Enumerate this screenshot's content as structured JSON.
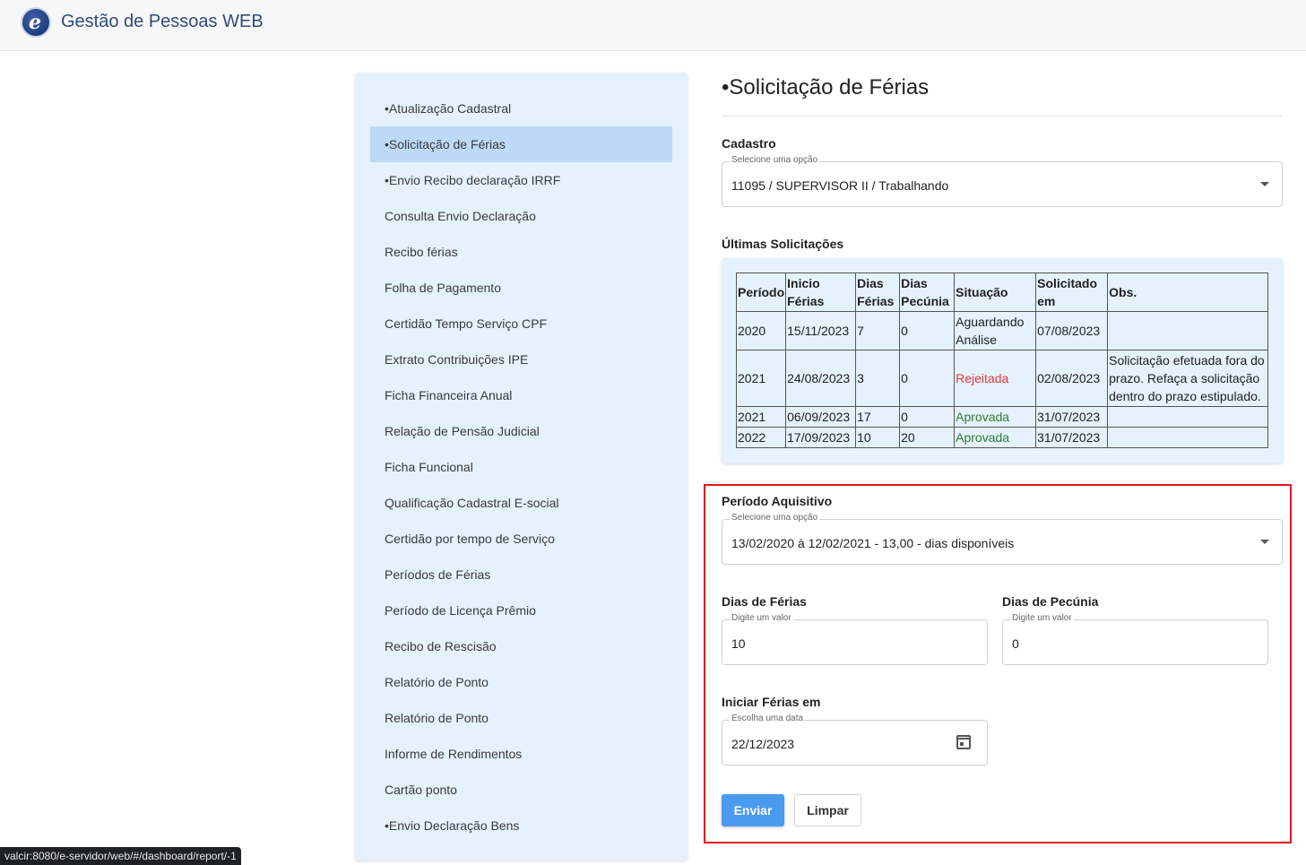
{
  "app": {
    "title": "Gestão de Pessoas WEB",
    "logo_letter": "e"
  },
  "sidebar": {
    "items": [
      {
        "label": "•Atualização Cadastral"
      },
      {
        "label": "•Solicitação de Férias",
        "active": true
      },
      {
        "label": "•Envio Recibo declaração IRRF"
      },
      {
        "label": "Consulta Envio Declaração"
      },
      {
        "label": "Recibo férias"
      },
      {
        "label": "Folha de Pagamento"
      },
      {
        "label": "Certidão Tempo Serviço CPF"
      },
      {
        "label": "Extrato Contribuições IPE"
      },
      {
        "label": "Ficha Financeira Anual"
      },
      {
        "label": "Relação de Pensão Judicial"
      },
      {
        "label": "Ficha Funcional"
      },
      {
        "label": "Qualificação Cadastral E-social"
      },
      {
        "label": "Certidão por tempo de Serviço"
      },
      {
        "label": "Períodos de Férias"
      },
      {
        "label": "Período de Licença Prêmio"
      },
      {
        "label": "Recibo de Rescisão"
      },
      {
        "label": "Relatório de Ponto"
      },
      {
        "label": "Relatório de Ponto"
      },
      {
        "label": "Informe de Rendimentos"
      },
      {
        "label": "Cartão ponto"
      },
      {
        "label": "•Envio Declaração Bens"
      }
    ]
  },
  "main": {
    "title": "•Solicitação de Férias",
    "cadastro": {
      "label": "Cadastro",
      "hint": "Selecione uma opção",
      "value": "11095 / SUPERVISOR II / Trabalhando"
    },
    "ultimas": {
      "label": "Últimas Solicitações",
      "headers": [
        "Período",
        "Inicio Férias",
        "Dias Férias",
        "Dias Pecúnia",
        "Situação",
        "Solicitado em",
        "Obs."
      ],
      "rows": [
        {
          "periodo": "2020",
          "inicio": "15/11/2023",
          "dias_ferias": "7",
          "dias_pecunia": "0",
          "situacao": "Aguardando Análise",
          "status": "pending",
          "solicitado": "07/08/2023",
          "obs": ""
        },
        {
          "periodo": "2021",
          "inicio": "24/08/2023",
          "dias_ferias": "3",
          "dias_pecunia": "0",
          "situacao": "Rejeitada",
          "status": "rejected",
          "solicitado": "02/08/2023",
          "obs": "Solicitação efetuada fora do prazo. Refaça a solicitação dentro do prazo estipulado."
        },
        {
          "periodo": "2021",
          "inicio": "06/09/2023",
          "dias_ferias": "17",
          "dias_pecunia": "0",
          "situacao": "Aprovada",
          "status": "approved",
          "solicitado": "31/07/2023",
          "obs": ""
        },
        {
          "periodo": "2022",
          "inicio": "17/09/2023",
          "dias_ferias": "10",
          "dias_pecunia": "20",
          "situacao": "Aprovada",
          "status": "approved",
          "solicitado": "31/07/2023",
          "obs": ""
        }
      ]
    },
    "periodo": {
      "label": "Período Aquisitivo",
      "hint": "Selecione uma opção",
      "value": "13/02/2020 à 12/02/2021 - 13,00 - dias disponíveis"
    },
    "dias_ferias": {
      "label": "Dias de Férias",
      "hint": "Digite um valor",
      "value": "10"
    },
    "dias_pecunia": {
      "label": "Dias de Pecúnia",
      "hint": "Digite um valor",
      "value": "0"
    },
    "iniciar": {
      "label": "Iniciar Férias em",
      "hint": "Escolha uma data",
      "value": "22/12/2023"
    },
    "buttons": {
      "enviar": "Enviar",
      "limpar": "Limpar"
    }
  },
  "statusbar": {
    "url": "valcir:8080/e-servidor/web/#/dashboard/report/-1"
  },
  "colors": {
    "accent": "#4a9af0",
    "sidebar_bg": "#e5f1fd",
    "active_item": "#bcdaf8",
    "rejected": "#e53935",
    "approved": "#2e7d32",
    "highlight": "#e0141e"
  }
}
